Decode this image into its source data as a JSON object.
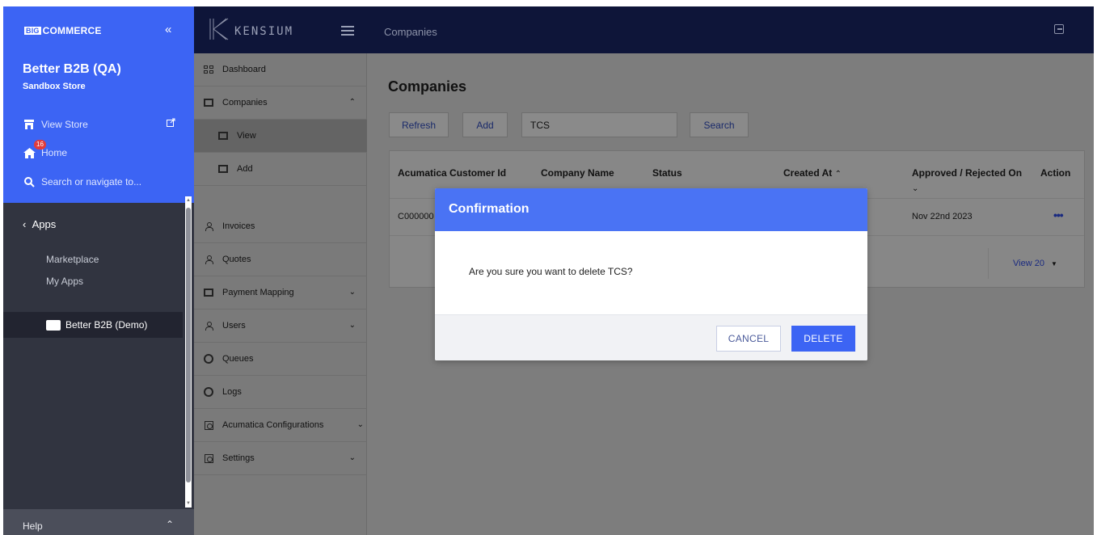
{
  "bigcommerce": {
    "brand": "COMMERCE",
    "brand_prefix": "BIG",
    "collapse_icon": "«",
    "store_name": "Better B2B (QA)",
    "store_sub": "Sandbox Store",
    "view_store": "View Store",
    "home": "Home",
    "home_badge": "16",
    "search_placeholder": "Search or navigate to...",
    "apps": "Apps",
    "marketplace": "Marketplace",
    "my_apps": "My Apps",
    "installed_app": "Better B2B (Demo)",
    "help": "Help"
  },
  "header": {
    "logo_word": "KENSIUM",
    "page": "Companies"
  },
  "sidebar": {
    "items": [
      {
        "label": "Dashboard"
      },
      {
        "label": "Companies"
      },
      {
        "label": "View"
      },
      {
        "label": "Add"
      },
      {
        "label": "Invoices"
      },
      {
        "label": "Quotes"
      },
      {
        "label": "Payment Mapping"
      },
      {
        "label": "Users"
      },
      {
        "label": "Queues"
      },
      {
        "label": "Logs"
      },
      {
        "label": "Acumatica Configurations"
      },
      {
        "label": "Settings"
      }
    ]
  },
  "main": {
    "title": "Companies",
    "refresh": "Refresh",
    "add": "Add",
    "search_value": "TCS",
    "search": "Search",
    "columns": {
      "customer_id": "Acumatica Customer Id",
      "company_name": "Company Name",
      "status": "Status",
      "created_at": "Created At",
      "approved": "Approved / Rejected On",
      "action": "Action"
    },
    "row": {
      "customer_id": "C000000",
      "approved_on": "Nov 22nd 2023",
      "action": "•••"
    },
    "pager": "View 20"
  },
  "modal": {
    "title": "Confirmation",
    "message": "Are you sure you want to delete TCS?",
    "cancel": "CANCEL",
    "delete": "DELETE"
  },
  "colors": {
    "bigcommerce_blue": "#3c64f4",
    "header_navy": "#0e1539",
    "modal_header": "#4a73f4"
  }
}
